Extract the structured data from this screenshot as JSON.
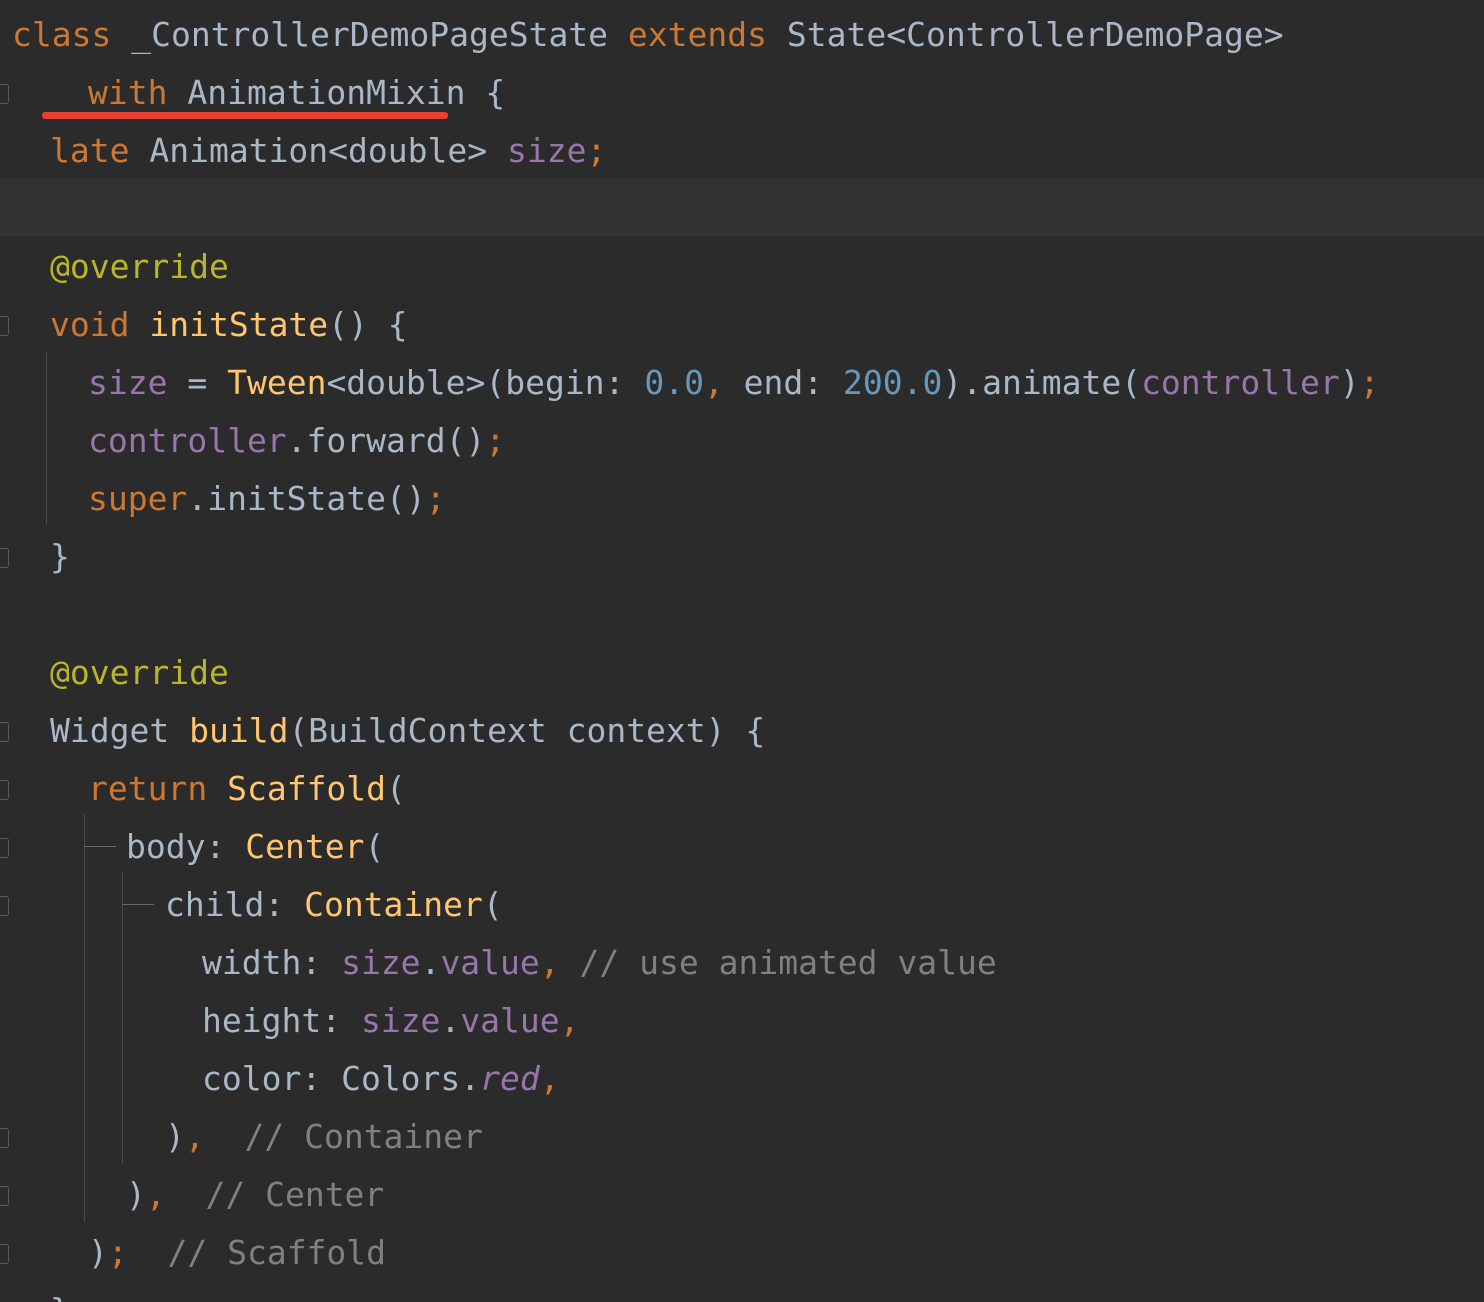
{
  "code": {
    "l1": {
      "kw_class": "class",
      "classname": "_ControllerDemoPageState",
      "kw_extends": "extends",
      "supertype": "State<ControllerDemoPage>"
    },
    "l2": {
      "kw_with": "with",
      "mixin": "AnimationMixin",
      "brace": "{"
    },
    "l3": {
      "kw_late": "late",
      "type": "Animation<double>",
      "field": "size",
      "semi": ";"
    },
    "l5": {
      "annotation": "@override"
    },
    "l6": {
      "kw_void": "void",
      "method": "initState",
      "rest": "() {"
    },
    "l7": {
      "field": "size",
      "eq": " = ",
      "cls": "Tween",
      "generic": "<double>(begin: ",
      "num1": "0.0",
      "comma1": ",",
      "mid": " end: ",
      "num2": "200.0",
      "after": ").animate(",
      "arg": "controller",
      "close": ")",
      "semi": ";"
    },
    "l8": {
      "field": "controller",
      "call": ".forward()",
      "semi": ";"
    },
    "l9": {
      "kw_super": "super",
      "call": ".initState()",
      "semi": ";"
    },
    "l10": {
      "brace": "}"
    },
    "l12": {
      "annotation": "@override"
    },
    "l13": {
      "type": "Widget",
      "method": "build",
      "params": "(BuildContext context) {"
    },
    "l14": {
      "kw_return": "return",
      "cls": "Scaffold",
      "paren": "("
    },
    "l15": {
      "prop": "body: ",
      "cls": "Center",
      "paren": "("
    },
    "l16": {
      "prop": "child: ",
      "cls": "Container",
      "paren": "("
    },
    "l17": {
      "prop": "width: ",
      "field1": "size",
      "dot": ".",
      "field2": "value",
      "comma": ",",
      "comment": " // use animated value"
    },
    "l18": {
      "prop": "height: ",
      "field1": "size",
      "dot": ".",
      "field2": "value",
      "comma": ","
    },
    "l19": {
      "prop": "color: ",
      "cls": "Colors",
      "dot": ".",
      "value": "red",
      "comma": ","
    },
    "l20": {
      "close": ")",
      "comma": ",",
      "comment": "  // Container"
    },
    "l21": {
      "close": ")",
      "comma": ",",
      "comment": "  // Center"
    },
    "l22": {
      "close": ")",
      "semi": ";",
      "comment": "  // Scaffold"
    },
    "l23": {
      "brace": "}"
    }
  }
}
